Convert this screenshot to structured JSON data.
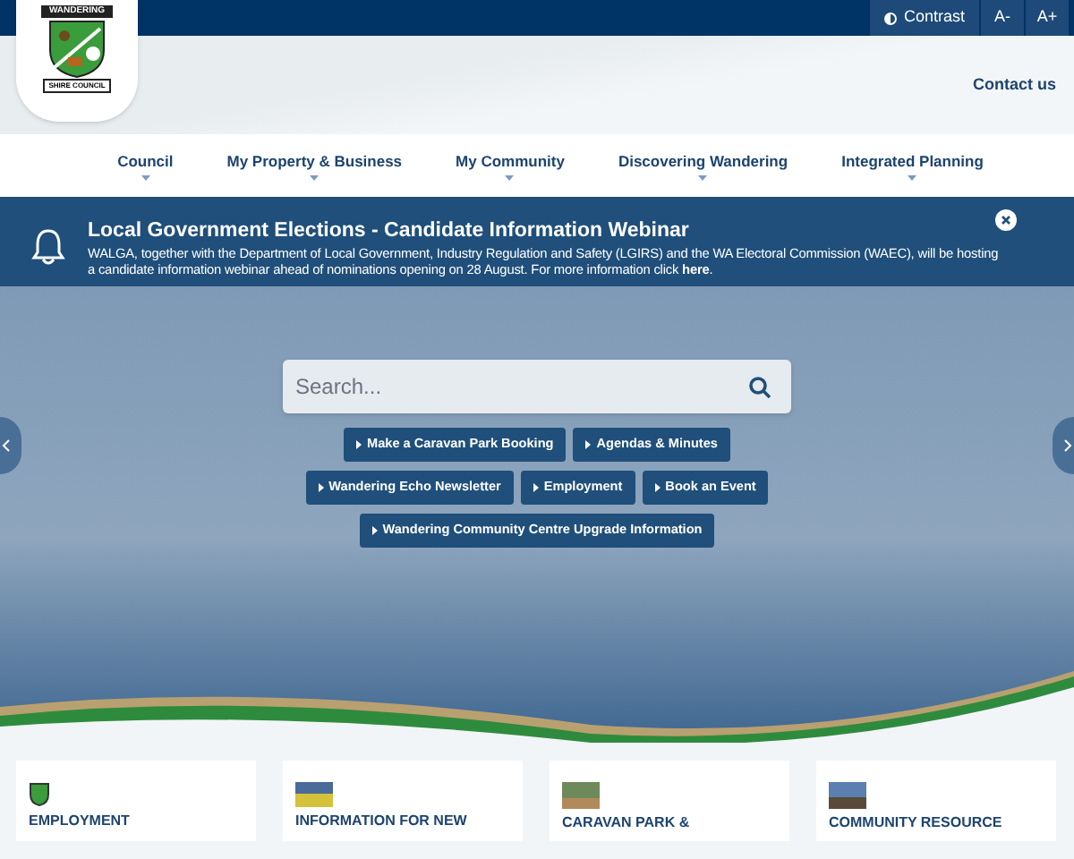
{
  "logo": {
    "top_text": "WANDERING",
    "bottom_text": "SHIRE COUNCIL"
  },
  "top_bar": {
    "contrast": "Contrast",
    "decrease": "A-",
    "increase": "A+"
  },
  "contact_link": "Contact us",
  "nav": [
    {
      "label": "Council"
    },
    {
      "label": "My Property & Business"
    },
    {
      "label": "My Community"
    },
    {
      "label": "Discovering Wandering"
    },
    {
      "label": "Integrated Planning"
    }
  ],
  "alert": {
    "title": "Local Government Elections - Candidate Information Webinar",
    "body": "WALGA, together with the Department of Local Government, Industry Regulation and Safety (LGIRS) and the WA Electoral Commission (WAEC), will be hosting a candidate information webinar ahead of nominations opening on 28 August.  For more information click ",
    "link": "here",
    "after": "."
  },
  "search": {
    "placeholder": "Search..."
  },
  "quick_links": [
    [
      "Make a Caravan Park Booking",
      "Agendas & Minutes"
    ],
    [
      "Wandering Echo Newsletter",
      "Employment",
      "Book an Event"
    ],
    [
      "Wandering Community Centre Upgrade Information"
    ]
  ],
  "cards": [
    {
      "kind": "crest",
      "title": "EMPLOYMENT"
    },
    {
      "kind": "field",
      "title": "INFORMATION FOR NEW"
    },
    {
      "kind": "trees",
      "title": "CARAVAN PARK &"
    },
    {
      "kind": "statue",
      "title": "COMMUNITY RESOURCE"
    }
  ]
}
